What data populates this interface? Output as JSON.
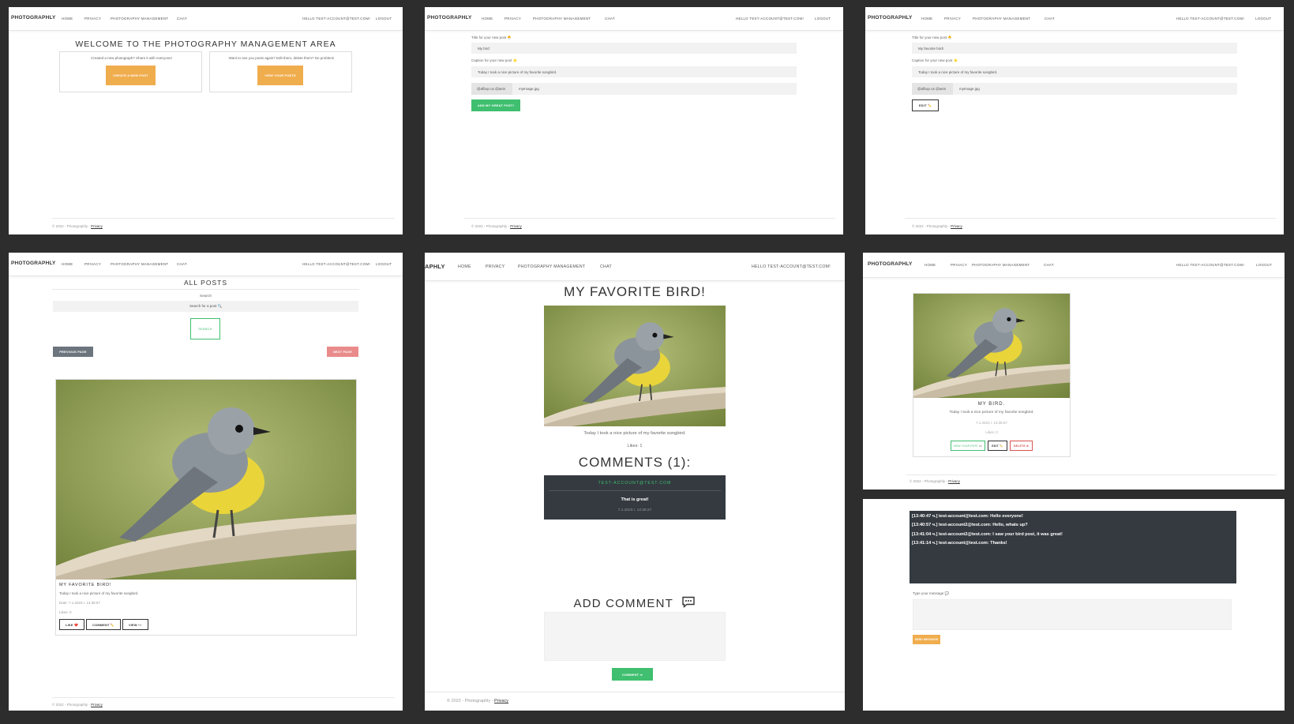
{
  "nav": {
    "brand": "PHOTOGRAPHLY",
    "brand_cropped": "APHLY",
    "home": "HOME",
    "privacy": "PRIVACY",
    "management": "PHOTOGRAPHY MANAGEMENT",
    "chat": "CHAT",
    "greeting": "HELLO TEST-ACCOUNT@TEST.COM!",
    "logout": "LOGOUT"
  },
  "footer": {
    "text": "© 2022 - Photographly - ",
    "privacy_link": "Privacy"
  },
  "management": {
    "title": "WELCOME TO THE PHOTOGRAPHY MANAGEMENT AREA",
    "create_text": "Created a new photograph? Share it with everyone!",
    "create_button": "CREATE A NEW POST",
    "view_text": "Want to see you posts again? Edit them, delete them? No problem!",
    "view_button": "VIEW YOUR POSTS"
  },
  "create_post": {
    "title_label": "Title for your new post 🐣",
    "title_value": "My bird",
    "caption_label": "Caption for your new post ⭐",
    "caption_value": "Today I took a nice picture of my favorite songbird.",
    "file_prefix": "@afbop us @aein",
    "file_value": "myImage.jpg",
    "submit_button": "ADD MY GREAT POST!"
  },
  "edit_post": {
    "title_label": "Title for your new post 🐣",
    "title_value": "My favorite bird!",
    "caption_label": "Caption for your new post ⭐",
    "caption_value": "Today I took a nice picture of my favorite songbird.",
    "file_prefix": "@afbop us @aein",
    "file_value": "myImage.jpg",
    "edit_button": "EDIT ✏️"
  },
  "all_posts": {
    "title": "ALL POSTS",
    "search_label": "Search",
    "search_placeholder": "Search for a post 🔍",
    "search_button": "SEARCH",
    "prev_button": "PREVIOUS PAGE",
    "next_button": "NEXT PAGE",
    "post_title": "MY FAVORITE BIRD!",
    "post_caption": "Today I took a nice picture of my favorite songbird.",
    "post_date": "Date: 7.1.2023 г. 13:36:57",
    "post_likes": "Likes: 0",
    "like_button": "LIKE ❤️",
    "comment_button": "COMMENT ✏️",
    "view_button": "VIEW 👀"
  },
  "post_detail": {
    "title": "MY FAVORITE BIRD!",
    "caption": "Today I took a nice picture of my favorite songbird.",
    "likes": "Likes: 1",
    "comments_title": "COMMENTS (1):",
    "comment_author": "TEST-ACCOUNT@TEST.COM",
    "comment_text": "That is great!",
    "comment_date": "7.1.2023 г. 13:39:27",
    "add_comment_title": "ADD COMMENT",
    "comment_submit": "COMMENT ➡"
  },
  "my_posts": {
    "post_title": "MY BIRD.",
    "post_caption": "Today I took a nice picture of my favorite songbird.",
    "post_date": "7.1.2023 г. 13:36:57",
    "post_likes": "Likes: 0",
    "view_button": "VIEW YOUR POST 👀",
    "edit_button": "EDIT ✏️",
    "delete_button": "DELETE ✖"
  },
  "chat": {
    "messages": [
      "[13:40:47 ч.] test-account@test.com: Hello everyone!",
      "[13:40:57 ч.] test-account2@test.com: Hello, whats up?",
      "[13:41:04 ч.] test-account2@test.com: I saw your bird post, it was great!",
      "[13:41:14 ч.] test-account@test.com: Thanks!"
    ],
    "message_label": "Type your message 💬",
    "send_button": "SEND MESSAGE"
  },
  "colors": {
    "orange": "#f0ad4e",
    "green": "#3fbf6f",
    "red": "#e98b8b",
    "dark": "#343a40",
    "gray_btn": "#6c757d",
    "page_bg": "#2d2d2d"
  }
}
